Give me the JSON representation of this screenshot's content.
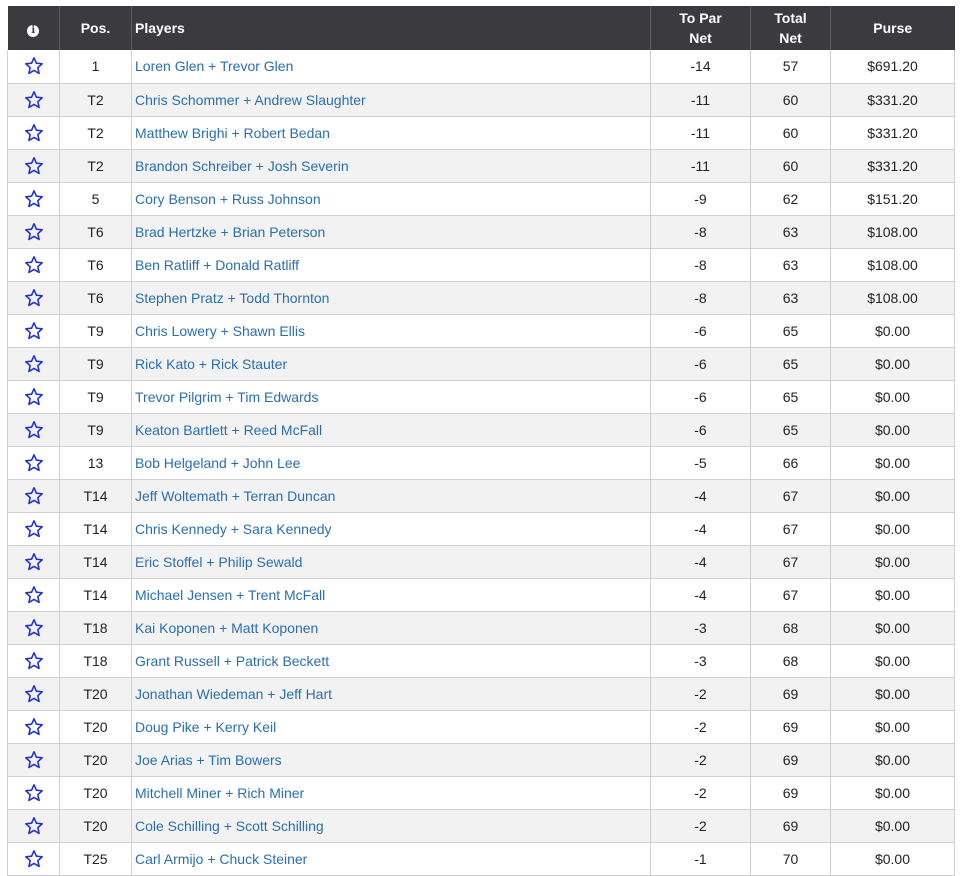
{
  "header": {
    "info_icon": "info-icon",
    "pos": "Pos.",
    "players": "Players",
    "to_par_line1": "To Par",
    "to_par_line2": "Net",
    "total_line1": "Total",
    "total_line2": "Net",
    "purse": "Purse"
  },
  "colors": {
    "header_bg": "#3a3a3f",
    "link": "#2a6eb0",
    "star": "#2233cc",
    "row_alt": "#f2f2f2"
  },
  "rows": [
    {
      "pos": "1",
      "players": "Loren Glen + Trevor Glen",
      "to_par": "-14",
      "total": "57",
      "purse": "$691.20"
    },
    {
      "pos": "T2",
      "players": "Chris Schommer + Andrew Slaughter",
      "to_par": "-11",
      "total": "60",
      "purse": "$331.20"
    },
    {
      "pos": "T2",
      "players": "Matthew Brighi + Robert Bedan",
      "to_par": "-11",
      "total": "60",
      "purse": "$331.20"
    },
    {
      "pos": "T2",
      "players": "Brandon Schreiber + Josh Severin",
      "to_par": "-11",
      "total": "60",
      "purse": "$331.20"
    },
    {
      "pos": "5",
      "players": "Cory Benson + Russ Johnson",
      "to_par": "-9",
      "total": "62",
      "purse": "$151.20"
    },
    {
      "pos": "T6",
      "players": "Brad Hertzke + Brian Peterson",
      "to_par": "-8",
      "total": "63",
      "purse": "$108.00"
    },
    {
      "pos": "T6",
      "players": "Ben Ratliff + Donald Ratliff",
      "to_par": "-8",
      "total": "63",
      "purse": "$108.00"
    },
    {
      "pos": "T6",
      "players": "Stephen Pratz + Todd Thornton",
      "to_par": "-8",
      "total": "63",
      "purse": "$108.00"
    },
    {
      "pos": "T9",
      "players": "Chris Lowery + Shawn Ellis",
      "to_par": "-6",
      "total": "65",
      "purse": "$0.00"
    },
    {
      "pos": "T9",
      "players": "Rick Kato + Rick Stauter",
      "to_par": "-6",
      "total": "65",
      "purse": "$0.00"
    },
    {
      "pos": "T9",
      "players": "Trevor Pilgrim + Tim Edwards",
      "to_par": "-6",
      "total": "65",
      "purse": "$0.00"
    },
    {
      "pos": "T9",
      "players": "Keaton Bartlett + Reed McFall",
      "to_par": "-6",
      "total": "65",
      "purse": "$0.00"
    },
    {
      "pos": "13",
      "players": "Bob Helgeland + John Lee",
      "to_par": "-5",
      "total": "66",
      "purse": "$0.00"
    },
    {
      "pos": "T14",
      "players": "Jeff Woltemath + Terran Duncan",
      "to_par": "-4",
      "total": "67",
      "purse": "$0.00"
    },
    {
      "pos": "T14",
      "players": "Chris Kennedy + Sara Kennedy",
      "to_par": "-4",
      "total": "67",
      "purse": "$0.00"
    },
    {
      "pos": "T14",
      "players": "Eric Stoffel + Philip Sewald",
      "to_par": "-4",
      "total": "67",
      "purse": "$0.00"
    },
    {
      "pos": "T14",
      "players": "Michael Jensen + Trent McFall",
      "to_par": "-4",
      "total": "67",
      "purse": "$0.00"
    },
    {
      "pos": "T18",
      "players": "Kai Koponen + Matt Koponen",
      "to_par": "-3",
      "total": "68",
      "purse": "$0.00"
    },
    {
      "pos": "T18",
      "players": "Grant Russell + Patrick Beckett",
      "to_par": "-3",
      "total": "68",
      "purse": "$0.00"
    },
    {
      "pos": "T20",
      "players": "Jonathan Wiedeman + Jeff Hart",
      "to_par": "-2",
      "total": "69",
      "purse": "$0.00"
    },
    {
      "pos": "T20",
      "players": "Doug Pike + Kerry Keil",
      "to_par": "-2",
      "total": "69",
      "purse": "$0.00"
    },
    {
      "pos": "T20",
      "players": "Joe Arias + Tim Bowers",
      "to_par": "-2",
      "total": "69",
      "purse": "$0.00"
    },
    {
      "pos": "T20",
      "players": "Mitchell Miner + Rich Miner",
      "to_par": "-2",
      "total": "69",
      "purse": "$0.00"
    },
    {
      "pos": "T20",
      "players": "Cole Schilling + Scott Schilling",
      "to_par": "-2",
      "total": "69",
      "purse": "$0.00"
    },
    {
      "pos": "T25",
      "players": "Carl Armijo + Chuck Steiner",
      "to_par": "-1",
      "total": "70",
      "purse": "$0.00"
    }
  ]
}
